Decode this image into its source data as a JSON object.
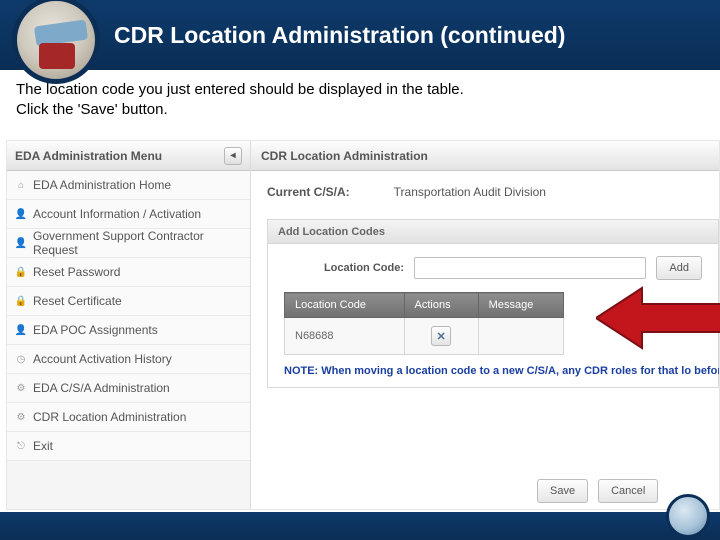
{
  "slide": {
    "title": "CDR Location Administration (continued)",
    "instruction_line1": "The location code you just entered should be displayed in the table.",
    "instruction_line2": "Click the 'Save' button."
  },
  "sidebar": {
    "title": "EDA Administration Menu",
    "collapse_glyph": "◂",
    "items": [
      {
        "icon": "home",
        "label": "EDA Administration Home"
      },
      {
        "icon": "user",
        "label": "Account Information / Activation"
      },
      {
        "icon": "user",
        "label": "Government Support Contractor Request"
      },
      {
        "icon": "lock",
        "label": "Reset Password"
      },
      {
        "icon": "lock",
        "label": "Reset Certificate"
      },
      {
        "icon": "user",
        "label": "EDA POC Assignments"
      },
      {
        "icon": "clock",
        "label": "Account Activation History"
      },
      {
        "icon": "gear",
        "label": "EDA C/S/A Administration"
      },
      {
        "icon": "gear",
        "label": "CDR Location Administration"
      },
      {
        "icon": "exit",
        "label": "Exit"
      }
    ],
    "icon_glyphs": {
      "home": "⌂",
      "user": "👤",
      "lock": "🔒",
      "clock": "◷",
      "gear": "⚙",
      "exit": "⎋"
    }
  },
  "main": {
    "title": "CDR Location Administration",
    "csa_label": "Current C/S/A:",
    "csa_value": "Transportation Audit Division",
    "panel_title": "Add Location Codes",
    "location_code_label": "Location Code:",
    "location_code_value": "",
    "add_label": "Add",
    "table": {
      "headers": [
        "Location Code",
        "Actions",
        "Message"
      ],
      "rows": [
        {
          "code": "N68688",
          "message": ""
        }
      ]
    },
    "remove_glyph": "✕",
    "note": "NOTE: When moving a location code to a new C/S/A, any CDR roles for that lo before saving.",
    "save_label": "Save",
    "cancel_label": "Cancel"
  },
  "colors": {
    "arrow": "#c3161c",
    "arrow_stroke": "#7c0f13"
  }
}
